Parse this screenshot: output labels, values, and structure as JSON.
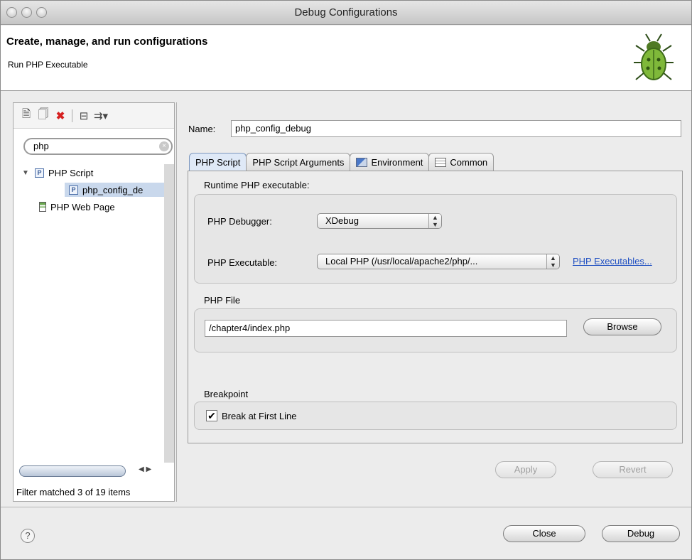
{
  "window": {
    "title": "Debug Configurations"
  },
  "banner": {
    "heading": "Create, manage, and run configurations",
    "subtitle": "Run PHP Executable"
  },
  "left": {
    "filter_value": "php",
    "tree": {
      "php_script": "PHP Script",
      "php_config": "php_config_de",
      "php_web_page": "PHP Web Page"
    },
    "status": "Filter matched 3 of 19 items"
  },
  "right": {
    "name_label": "Name:",
    "name_value": "php_config_debug",
    "tabs": [
      {
        "label": "PHP Script"
      },
      {
        "label": "PHP Script Arguments"
      },
      {
        "label": "Environment"
      },
      {
        "label": "Common"
      }
    ],
    "runtime_heading": "Runtime PHP executable:",
    "debugger_label": "PHP Debugger:",
    "debugger_value": "XDebug",
    "executable_label": "PHP Executable:",
    "executable_value": "Local PHP (/usr/local/apache2/php/...",
    "executables_link": "PHP Executables...",
    "file_heading": "PHP File",
    "file_value": "/chapter4/index.php",
    "browse": "Browse",
    "breakpoint_heading": "Breakpoint",
    "break_first_line": "Break at First Line",
    "break_first_line_checked": true,
    "apply": "Apply",
    "revert": "Revert"
  },
  "footer": {
    "help": "?",
    "close": "Close",
    "debug": "Debug"
  }
}
